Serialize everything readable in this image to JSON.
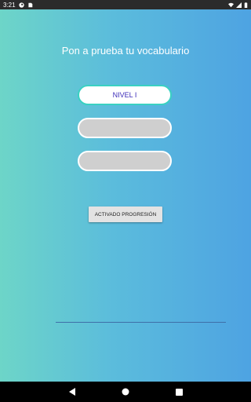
{
  "status_bar": {
    "time": "3:21",
    "icons_left": [
      "notification-circle-icon",
      "sd-card-icon"
    ],
    "icons_right": [
      "wifi-icon",
      "signal-icon",
      "battery-icon"
    ]
  },
  "title": "Pon a prueba tu vocabulario",
  "levels": [
    {
      "label": "NIVEL I"
    },
    {
      "label": ""
    },
    {
      "label": ""
    }
  ],
  "progression_button": "ACTIVADO PROGRESIÓN",
  "nav": {
    "back": "back-icon",
    "home": "home-icon",
    "recents": "recents-icon"
  },
  "colors": {
    "gradient_start": "#6dd5c8",
    "gradient_end": "#4ea3e2",
    "level_border_active": "#3ad1c2",
    "level_text": "#3a2ab8",
    "level_disabled_fill": "#cfcfcf"
  }
}
